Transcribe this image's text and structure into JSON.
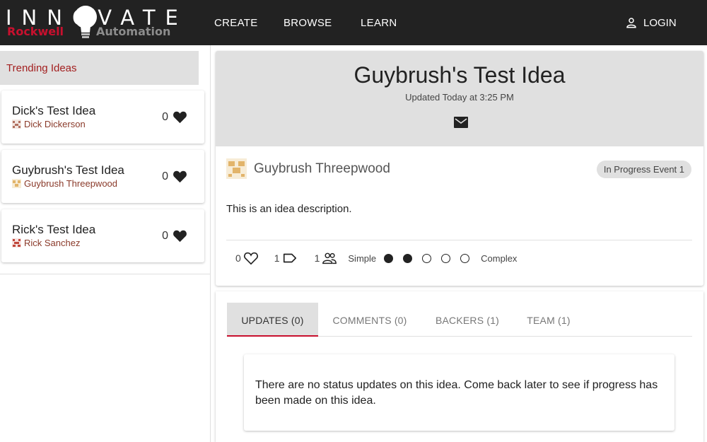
{
  "brand": {
    "top": "INNOVATE",
    "bottom_left": "Rockwell",
    "bottom_right": "Automation"
  },
  "nav": {
    "create": "CREATE",
    "browse": "BROWSE",
    "learn": "LEARN",
    "login": "LOGIN"
  },
  "sidebar": {
    "heading": "Trending Ideas",
    "ideas": [
      {
        "title": "Dick's Test Idea",
        "author": "Dick Dickerson",
        "likes": "0"
      },
      {
        "title": "Guybrush's Test Idea",
        "author": "Guybrush Threepwood",
        "likes": "0"
      },
      {
        "title": "Rick's Test Idea",
        "author": "Rick Sanchez",
        "likes": "0"
      }
    ]
  },
  "idea": {
    "title": "Guybrush's Test Idea",
    "updated": "Updated  Today at 3:25 PM",
    "owner": "Guybrush Threepwood",
    "status": "In Progress Event 1",
    "description": "This is an idea description.",
    "likes": "0",
    "tags": "1",
    "team": "1",
    "complexity_low": "Simple",
    "complexity_high": "Complex",
    "complexity_level": 2,
    "complexity_max": 5
  },
  "tabs": {
    "updates": "UPDATES (0)",
    "comments": "COMMENTS (0)",
    "backers": "BACKERS (1)",
    "team": "TEAM (1)",
    "active": "updates"
  },
  "updates": {
    "empty_message": "There are no status updates on this idea. Come back later to see if progress has been made on this idea."
  },
  "colors": {
    "topbar": "#222222",
    "brand_red": "#c8102e",
    "panel_gray": "#e0e0e0"
  }
}
